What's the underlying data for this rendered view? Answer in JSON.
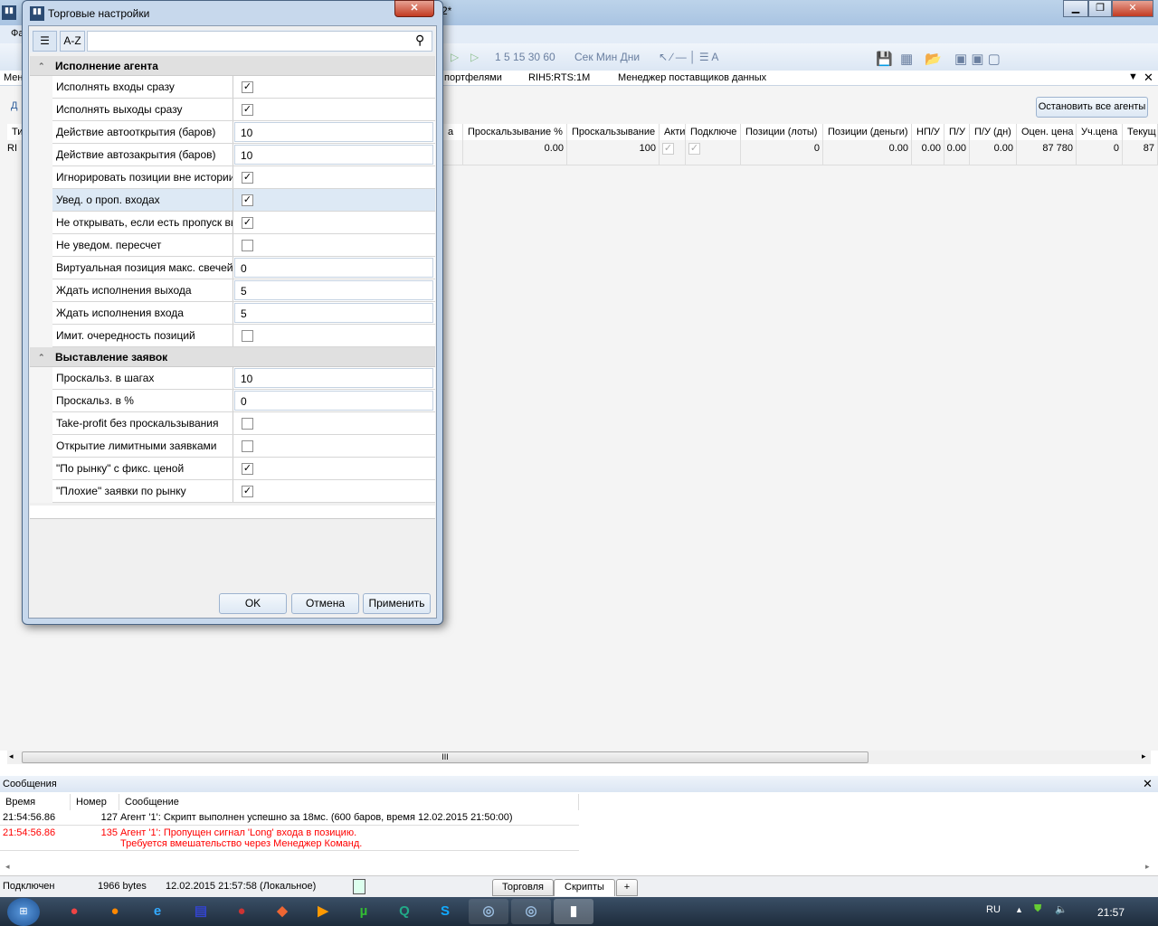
{
  "app": {
    "title_suffix": "2*",
    "menu_first": "Фа",
    "left_label_1": "Мен",
    "left_tab": "Д",
    "left_col": "Ти",
    "left_cell": "RI",
    "toolbar": {
      "intervals": "1 5 15 30 60",
      "units": "Сек Мин Дни"
    },
    "tabs": [
      "портфелями",
      "RIH5:RTS:1M",
      "Менеджер поставщиков данных"
    ],
    "stop_all_button": "Остановить все агенты",
    "table": {
      "headers": [
        "а",
        "Проскальзывание %",
        "Проскальзывание",
        "Акти",
        "Подключе",
        "Позиции (лоты)",
        "Позиции (деньги)",
        "НП/У",
        "П/У",
        "П/У (дн)",
        "Оцен. цена",
        "Уч.цена",
        "Текущ"
      ],
      "row": [
        "",
        "0.00",
        "100",
        "checked",
        "checked",
        "0",
        "0.00",
        "0.00",
        "0.00",
        "0.00",
        "87 780",
        "0",
        "87"
      ]
    },
    "scroll_grip": "III"
  },
  "messages": {
    "title": "Сообщения",
    "headers": [
      "Время",
      "Номер",
      "Сообщение"
    ],
    "rows": [
      {
        "time": "21:54:56.86",
        "num": "127",
        "text": "Агент '1': Скрипт выполнен успешно за 18мс. (600 баров, время 12.02.2015 21:50:00)",
        "text2": "",
        "color": "#000000"
      },
      {
        "time": "21:54:56.86",
        "num": "135",
        "text": "Агент '1': Пропущен сигнал 'Long' входа в позицию.",
        "text2": "Требуется вмешательство через Менеджер Команд.",
        "color": "#ff0000"
      }
    ]
  },
  "status": {
    "conn": "Подключен",
    "bytes": "1966 bytes",
    "time": "12.02.2015 21:57:58 (Локальное)",
    "tabs": [
      "Торговля",
      "Скрипты",
      "+"
    ],
    "active_tab": "Скрипты"
  },
  "taskbar": {
    "lang": "RU",
    "clock": "21:57"
  },
  "dialog": {
    "title": "Торговые настройки",
    "az": "A-Z",
    "search_value": "",
    "sections": [
      {
        "title": "Исполнение агента",
        "rows": [
          {
            "label": "Исполнять входы сразу",
            "type": "check",
            "value": true
          },
          {
            "label": "Исполнять выходы сразу",
            "type": "check",
            "value": true
          },
          {
            "label": "Действие автооткрытия (баров)",
            "type": "text",
            "value": "10"
          },
          {
            "label": "Действие автозакрытия (баров)",
            "type": "text",
            "value": "10"
          },
          {
            "label": "Игнорировать позиции вне истории",
            "type": "check",
            "value": true
          },
          {
            "label": "Увед. о проп. входах",
            "type": "check",
            "value": true,
            "selected": true
          },
          {
            "label": "Не открывать, если есть пропуск вых",
            "type": "check",
            "value": true
          },
          {
            "label": "Не уведом. пересчет",
            "type": "check",
            "value": false
          },
          {
            "label": "Виртуальная позиция макс. свечей",
            "type": "text",
            "value": "0"
          },
          {
            "label": "Ждать исполнения выхода",
            "type": "text",
            "value": "5"
          },
          {
            "label": "Ждать исполнения входа",
            "type": "text",
            "value": "5"
          },
          {
            "label": "Имит. очередность позиций",
            "type": "check",
            "value": false
          }
        ]
      },
      {
        "title": "Выставление заявок",
        "rows": [
          {
            "label": "Проскальз. в шагах",
            "type": "text",
            "value": "10"
          },
          {
            "label": "Проскальз. в %",
            "type": "text",
            "value": "0"
          },
          {
            "label": "Take-profit без проскальзывания",
            "type": "check",
            "value": false
          },
          {
            "label": "Открытие лимитными заявками",
            "type": "check",
            "value": false
          },
          {
            "label": "\"По рынку\" с фикс. ценой",
            "type": "check",
            "value": true
          },
          {
            "label": "\"Плохие\" заявки по рынку",
            "type": "check",
            "value": true
          }
        ]
      }
    ],
    "buttons": {
      "ok": "OK",
      "cancel": "Отмена",
      "apply": "Применить"
    }
  }
}
